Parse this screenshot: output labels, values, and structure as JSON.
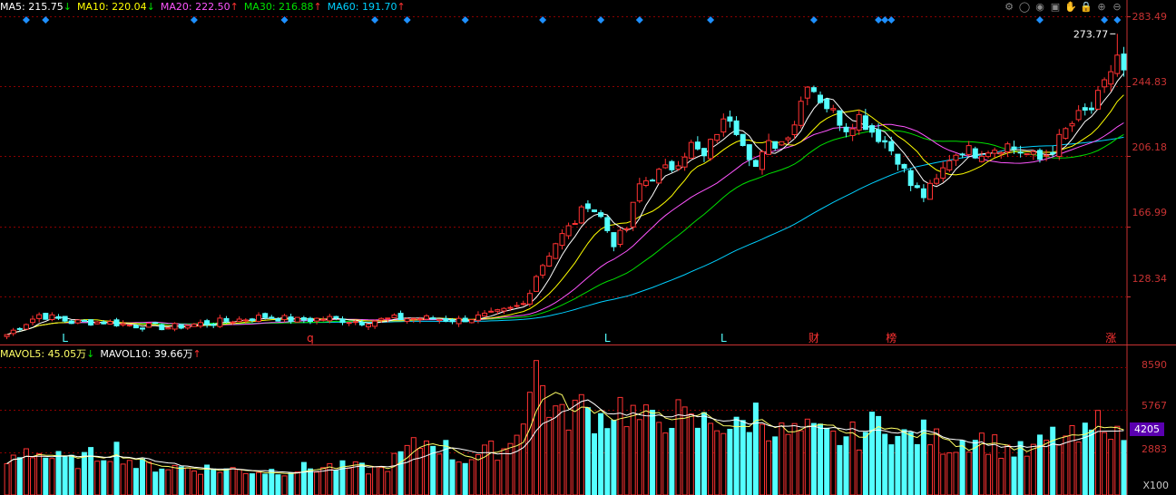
{
  "header": {
    "ma": [
      {
        "label": "MA5: 215.75",
        "arrow": "↓",
        "color": "#ffffff"
      },
      {
        "label": "MA10: 220.04",
        "arrow": "↓",
        "color": "#ffff00"
      },
      {
        "label": "MA20: 222.50",
        "arrow": "↑",
        "color": "#ff55ff"
      },
      {
        "label": "MA30: 216.88",
        "arrow": "↑",
        "color": "#00e000"
      },
      {
        "label": "MA60: 191.70",
        "arrow": "↑",
        "color": "#00d0ff"
      }
    ],
    "vol": [
      {
        "label": "MAVOL5: 45.05万",
        "arrow": "↓",
        "color": "#ffff66"
      },
      {
        "label": "MAVOL10: 39.66万",
        "arrow": "↑",
        "color": "#ffffff"
      }
    ]
  },
  "toolbar": {
    "icons": [
      "settings-icon",
      "circle-icon",
      "eye-icon",
      "gift-icon",
      "hand-icon",
      "lock-icon",
      "zoom-in-icon",
      "zoom-out-icon"
    ]
  },
  "colors": {
    "up": "#ff3232",
    "down": "#54ffff",
    "grid": "#8b0000",
    "ma5": "#ffffff",
    "ma10": "#ffff00",
    "ma20": "#ff55ff",
    "ma30": "#00e000",
    "ma60": "#00d0ff",
    "axis_text": "#c83232",
    "marker": "#1e90ff"
  },
  "chart_data": {
    "type": "candlestick",
    "price_axis": {
      "ticks": [
        "283.49",
        "244.83",
        "206.18",
        "166.99",
        "128.34"
      ],
      "range": [
        102.0,
        283.49
      ]
    },
    "volume_axis": {
      "ticks": [
        "8590",
        "5767",
        "2883"
      ],
      "unit": "X100",
      "current_tag": "4205",
      "range": [
        0,
        9100
      ]
    },
    "peak_annotation": {
      "label": "273.77",
      "value": 273.77
    },
    "event_labels": [
      {
        "text": "L",
        "color": "#54ffff",
        "index": 9
      },
      {
        "text": "q",
        "color": "#ff3232",
        "index": 47
      },
      {
        "text": "L",
        "color": "#54ffff",
        "index": 93
      },
      {
        "text": "L",
        "color": "#54ffff",
        "index": 111
      },
      {
        "text": "财",
        "color": "#ff3232",
        "index": 125
      },
      {
        "text": "榜",
        "color": "#ff3232",
        "index": 137
      },
      {
        "text": "涨",
        "color": "#ff3232",
        "index": 171
      }
    ],
    "marker_indices": [
      3,
      6,
      29,
      43,
      57,
      62,
      71,
      83,
      92,
      98,
      109,
      125,
      135,
      136,
      137,
      160,
      170,
      172
    ],
    "close_anchors": [
      [
        0,
        107
      ],
      [
        5,
        118
      ],
      [
        10,
        114
      ],
      [
        15,
        114
      ],
      [
        20,
        112
      ],
      [
        25,
        111
      ],
      [
        30,
        113
      ],
      [
        35,
        115
      ],
      [
        40,
        117
      ],
      [
        45,
        115
      ],
      [
        50,
        116
      ],
      [
        55,
        114
      ],
      [
        60,
        116
      ],
      [
        65,
        116
      ],
      [
        70,
        115
      ],
      [
        75,
        118
      ],
      [
        78,
        121
      ],
      [
        80,
        124
      ],
      [
        82,
        140
      ],
      [
        85,
        158
      ],
      [
        88,
        170
      ],
      [
        90,
        180
      ],
      [
        92,
        172
      ],
      [
        94,
        158
      ],
      [
        96,
        166
      ],
      [
        98,
        190
      ],
      [
        100,
        195
      ],
      [
        103,
        200
      ],
      [
        106,
        212
      ],
      [
        108,
        205
      ],
      [
        110,
        220
      ],
      [
        112,
        228
      ],
      [
        114,
        215
      ],
      [
        116,
        200
      ],
      [
        118,
        212
      ],
      [
        120,
        214
      ],
      [
        122,
        225
      ],
      [
        124,
        248
      ],
      [
        126,
        238
      ],
      [
        128,
        230
      ],
      [
        130,
        222
      ],
      [
        132,
        228
      ],
      [
        134,
        220
      ],
      [
        136,
        214
      ],
      [
        138,
        205
      ],
      [
        140,
        190
      ],
      [
        142,
        184
      ],
      [
        144,
        192
      ],
      [
        146,
        205
      ],
      [
        148,
        210
      ],
      [
        150,
        208
      ],
      [
        152,
        210
      ],
      [
        155,
        212
      ],
      [
        158,
        207
      ],
      [
        160,
        204
      ],
      [
        162,
        210
      ],
      [
        164,
        220
      ],
      [
        166,
        228
      ],
      [
        168,
        232
      ],
      [
        170,
        245
      ],
      [
        172,
        262
      ],
      [
        173,
        252
      ]
    ],
    "volume_anchors": [
      [
        0,
        2200
      ],
      [
        3,
        3200
      ],
      [
        6,
        2600
      ],
      [
        10,
        2200
      ],
      [
        17,
        3100
      ],
      [
        20,
        2000
      ],
      [
        30,
        1800
      ],
      [
        40,
        1600
      ],
      [
        50,
        1900
      ],
      [
        58,
        1700
      ],
      [
        62,
        3000
      ],
      [
        66,
        3800
      ],
      [
        70,
        2400
      ],
      [
        74,
        2800
      ],
      [
        78,
        3400
      ],
      [
        81,
        7000
      ],
      [
        82,
        8400
      ],
      [
        84,
        6200
      ],
      [
        86,
        5000
      ],
      [
        88,
        6000
      ],
      [
        90,
        5600
      ],
      [
        92,
        5200
      ],
      [
        95,
        6000
      ],
      [
        98,
        5100
      ],
      [
        100,
        4800
      ],
      [
        103,
        5600
      ],
      [
        106,
        4700
      ],
      [
        110,
        5000
      ],
      [
        113,
        4400
      ],
      [
        116,
        5500
      ],
      [
        120,
        4100
      ],
      [
        124,
        4200
      ],
      [
        128,
        3800
      ],
      [
        132,
        4000
      ],
      [
        136,
        5200
      ],
      [
        138,
        3800
      ],
      [
        142,
        4100
      ],
      [
        146,
        3300
      ],
      [
        150,
        4000
      ],
      [
        154,
        3200
      ],
      [
        158,
        2800
      ],
      [
        162,
        3900
      ],
      [
        166,
        3700
      ],
      [
        168,
        4200
      ],
      [
        170,
        5500
      ],
      [
        171,
        4900
      ],
      [
        172,
        3800
      ],
      [
        173,
        4205
      ]
    ]
  }
}
